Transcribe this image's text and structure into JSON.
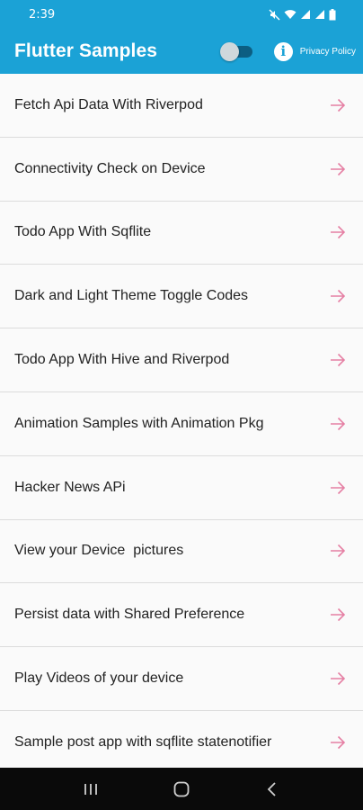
{
  "status_bar": {
    "time": "2:39",
    "icons": [
      "mute-icon",
      "wifi-icon",
      "signal-icon",
      "signal-icon",
      "battery-icon"
    ]
  },
  "app_bar": {
    "title": "Flutter Samples",
    "theme_toggle": {
      "on": false
    },
    "privacy_label": "Privacy Policy",
    "colors": {
      "bar": "#1ba2d6",
      "text": "#ffffff"
    }
  },
  "list": {
    "items": [
      {
        "label": "Fetch Api Data With Riverpod"
      },
      {
        "label": "Connectivity Check on Device"
      },
      {
        "label": "Todo App With Sqflite"
      },
      {
        "label": "Dark and Light Theme Toggle Codes"
      },
      {
        "label": "Todo App With Hive and Riverpod"
      },
      {
        "label": "Animation Samples with Animation Pkg"
      },
      {
        "label": "Hacker News APi"
      },
      {
        "label": "View your Device  pictures"
      },
      {
        "label": "Persist data with Shared Preference"
      },
      {
        "label": "Play Videos of your device"
      },
      {
        "label": "Sample post app with sqflite statenotifier"
      }
    ],
    "arrow_icon": "arrow-right-icon",
    "arrow_color": "#e57fa3"
  },
  "nav_bar": {
    "buttons": [
      "recents-icon",
      "home-icon",
      "back-icon"
    ]
  }
}
